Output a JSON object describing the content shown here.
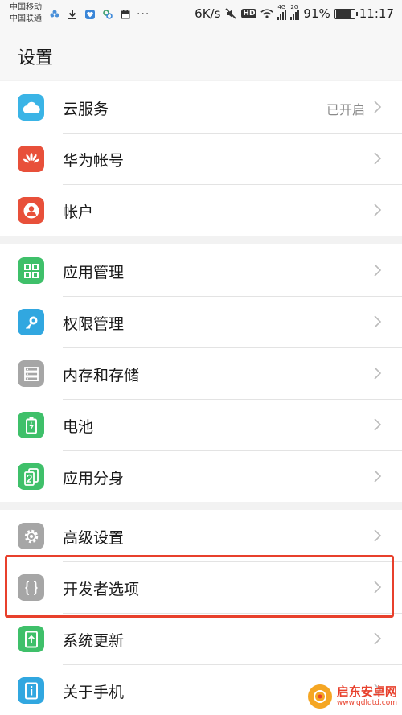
{
  "status": {
    "carrier1": "中国移动",
    "carrier2": "中国联通",
    "speed": "6K/s",
    "hd": "HD",
    "net1": "4G",
    "net2": "2G",
    "battery": "91%",
    "battery_level": 0.91,
    "time": "11:17"
  },
  "header": {
    "title": "设置"
  },
  "groups": [
    {
      "items": [
        {
          "label": "云服务",
          "value": "已开启",
          "icon": "cloud-icon",
          "color": "#3ab4e6"
        },
        {
          "label": "华为帐号",
          "icon": "huawei-logo-icon",
          "color": "#e8503a"
        },
        {
          "label": "帐户",
          "icon": "person-icon",
          "color": "#e8503a"
        }
      ]
    },
    {
      "items": [
        {
          "label": "应用管理",
          "icon": "grid-apps-icon",
          "color": "#3fc06a"
        },
        {
          "label": "权限管理",
          "icon": "key-icon",
          "color": "#31a7e0"
        },
        {
          "label": "内存和存储",
          "icon": "storage-icon",
          "color": "#a6a6a6"
        },
        {
          "label": "电池",
          "icon": "battery-icon",
          "color": "#3fc06a"
        },
        {
          "label": "应用分身",
          "icon": "app-twin-icon",
          "color": "#3fc06a"
        }
      ]
    },
    {
      "items": [
        {
          "label": "高级设置",
          "icon": "gear-icon",
          "color": "#a6a6a6"
        },
        {
          "label": "开发者选项",
          "icon": "braces-icon",
          "color": "#a6a6a6"
        },
        {
          "label": "系统更新",
          "icon": "system-update-icon",
          "color": "#3fc06a"
        },
        {
          "label": "关于手机",
          "icon": "info-icon",
          "color": "#31a7e0"
        }
      ]
    }
  ],
  "highlight_color": "#e8402c",
  "watermark": {
    "name": "启东安卓网",
    "url": "www.qdldtd.com"
  }
}
